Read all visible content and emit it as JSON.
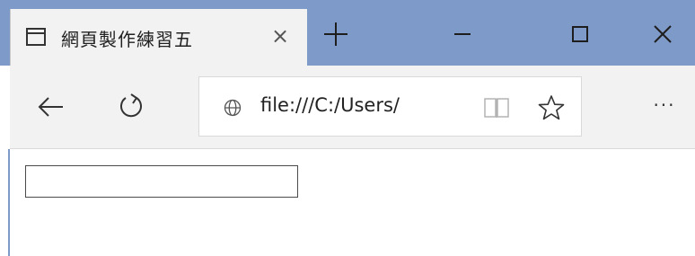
{
  "window": {
    "tab": {
      "title": "網頁製作練習五",
      "close_glyph": "×",
      "icon": "page-icon"
    },
    "new_tab_icon": "plus-icon",
    "controls": {
      "minimize_icon": "minimize-icon",
      "maximize_icon": "maximize-icon",
      "close_icon": "close-icon"
    },
    "colors": {
      "title_bar": "#7e9ac9",
      "tab_background": "#f2f2f2",
      "nav_background": "#f2f2f2"
    }
  },
  "navigation": {
    "back_icon": "arrow-left-icon",
    "refresh_icon": "refresh-icon",
    "address": {
      "url": "file:///C:/Users/",
      "globe_icon": "globe-icon",
      "reading_view_icon": "book-icon",
      "favorite_icon": "star-icon"
    },
    "more_label": "···"
  },
  "content": {
    "text_input": {
      "value": "",
      "placeholder": ""
    }
  }
}
